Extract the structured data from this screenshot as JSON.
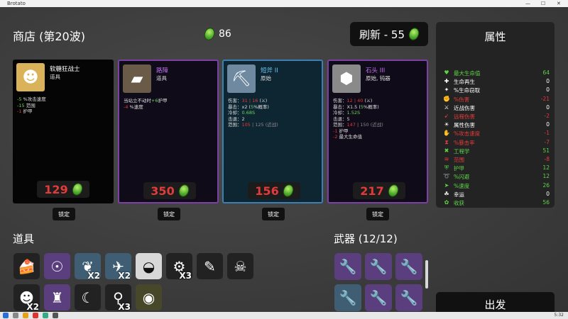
{
  "window": {
    "title": "Brotato"
  },
  "shop": {
    "title": "商店 (第20波)",
    "money": "86",
    "reroll_label": "刷新 - 55"
  },
  "cards": [
    {
      "name": "软糖狂战士",
      "type": "道具",
      "icon": "gummy-berserker-icon",
      "lines": [
        [
          {
            "t": "-5",
            "c": "g"
          },
          {
            "t": " %攻击速度",
            "c": ""
          }
        ],
        [
          {
            "t": "-15",
            "c": "g"
          },
          {
            "t": " 范围",
            "c": ""
          }
        ],
        [
          {
            "t": "-1",
            "c": "r"
          },
          {
            "t": " 护甲",
            "c": ""
          }
        ]
      ],
      "price": "129"
    },
    {
      "name": "路障",
      "type": "道具",
      "icon": "barricade-icon",
      "lines": [
        [
          {
            "t": "当站立不动时",
            "c": ""
          },
          {
            "t": "+6",
            "c": "g"
          },
          {
            "t": "护甲",
            "c": ""
          }
        ],
        [
          {
            "t": "-4",
            "c": "r"
          },
          {
            "t": " %速度",
            "c": ""
          }
        ]
      ],
      "price": "350"
    },
    {
      "name": "短斧 II",
      "type": "原始",
      "icon": "hatchet-icon",
      "lines": [
        [
          {
            "t": "伤害：",
            "c": ""
          },
          {
            "t": "31 | 16",
            "c": "r"
          },
          {
            "t": " (⚔)",
            "c": ""
          }
        ],
        [
          {
            "t": "暴击：x2 (",
            "c": ""
          },
          {
            "t": "5",
            "c": "g"
          },
          {
            "t": "%概率)",
            "c": ""
          }
        ],
        [
          {
            "t": "冷却：",
            "c": ""
          },
          {
            "t": "0.68S",
            "c": "g"
          }
        ],
        [
          {
            "t": "击退：2",
            "c": ""
          }
        ],
        [
          {
            "t": "范围：",
            "c": ""
          },
          {
            "t": "105",
            "c": "r"
          },
          {
            "t": " | 125  (近战)",
            "c": "gr"
          }
        ]
      ],
      "price": "156"
    },
    {
      "name": "石头 III",
      "type": "原始, 钝器",
      "icon": "rock-icon",
      "lines": [
        [
          {
            "t": "伤害：",
            "c": ""
          },
          {
            "t": "12 | 40",
            "c": "r"
          },
          {
            "t": " (⚔)",
            "c": ""
          }
        ],
        [
          {
            "t": "暴击：X1.5 (",
            "c": ""
          },
          {
            "t": "5",
            "c": "g"
          },
          {
            "t": "%概率)",
            "c": ""
          }
        ],
        [
          {
            "t": "冷却：",
            "c": ""
          },
          {
            "t": "1.52S",
            "c": "g"
          }
        ],
        [
          {
            "t": "击退：5",
            "c": ""
          }
        ],
        [
          {
            "t": "范围：",
            "c": ""
          },
          {
            "t": "147",
            "c": "r"
          },
          {
            "t": " | 150  (近战)",
            "c": "gr"
          }
        ],
        [
          {
            "t": "-1",
            "c": "r"
          },
          {
            "t": " 护甲",
            "c": ""
          }
        ],
        [
          {
            "t": "-2",
            "c": "r"
          },
          {
            "t": " 最大生命值",
            "c": ""
          }
        ]
      ],
      "price": "217"
    }
  ],
  "lock_label": "锁定",
  "stats": {
    "title": "属性",
    "rows": [
      {
        "icon": "heart-icon",
        "sym": "♥",
        "label": "最大生命值",
        "value": "64",
        "color": "#5fd447"
      },
      {
        "icon": "regen-icon",
        "sym": "✚",
        "label": "生命再生",
        "value": "0",
        "color": "#ffffff"
      },
      {
        "icon": "lifesteal-icon",
        "sym": "✦",
        "label": "%生命窃取",
        "value": "0",
        "color": "#ffffff"
      },
      {
        "icon": "damage-icon",
        "sym": "✊",
        "label": "%伤害",
        "value": "-21",
        "color": "#e23b3b"
      },
      {
        "icon": "melee-icon",
        "sym": "⚔",
        "label": "近战伤害",
        "value": "0",
        "color": "#ffffff"
      },
      {
        "icon": "ranged-icon",
        "sym": "➹",
        "label": "远程伤害",
        "value": "-2",
        "color": "#e23b3b"
      },
      {
        "icon": "elemental-icon",
        "sym": "☀",
        "label": "属性伤害",
        "value": "0",
        "color": "#ffffff"
      },
      {
        "icon": "attack-speed-icon",
        "sym": "✋",
        "label": "%攻击速度",
        "value": "-1",
        "color": "#e23b3b"
      },
      {
        "icon": "crit-icon",
        "sym": "⧗",
        "label": "%暴击率",
        "value": "-7",
        "color": "#e23b3b"
      },
      {
        "icon": "engineering-icon",
        "sym": "✖",
        "label": "工程学",
        "value": "51",
        "color": "#5fd447"
      },
      {
        "icon": "range-icon",
        "sym": "≋",
        "label": "范围",
        "value": "-8",
        "color": "#e23b3b"
      },
      {
        "icon": "armor-icon",
        "sym": "⛨",
        "label": "护甲",
        "value": "12",
        "color": "#5fd447"
      },
      {
        "icon": "dodge-icon",
        "sym": "➰",
        "label": "%闪避",
        "value": "12",
        "color": "#5fd447"
      },
      {
        "icon": "speed-icon",
        "sym": "➤",
        "label": "%速度",
        "value": "26",
        "color": "#5fd447"
      },
      {
        "icon": "luck-icon",
        "sym": "☘",
        "label": "幸运",
        "value": "0",
        "color": "#ffffff"
      },
      {
        "icon": "harvesting-icon",
        "sym": "✿",
        "label": "收获",
        "value": "56",
        "color": "#5fd447"
      }
    ]
  },
  "inventory": {
    "items_title": "道具",
    "items": [
      {
        "icon": "cake-icon",
        "sym": "🍰",
        "rarity": "",
        "count": ""
      },
      {
        "icon": "amulet-icon",
        "sym": "☉",
        "rarity": "purple",
        "count": ""
      },
      {
        "icon": "feather-icon",
        "sym": "❦",
        "rarity": "blue",
        "count": "X2"
      },
      {
        "icon": "wings-icon",
        "sym": "✈",
        "rarity": "blue",
        "count": "X2"
      },
      {
        "icon": "helmet-icon",
        "sym": "◒",
        "rarity": "white",
        "count": ""
      },
      {
        "icon": "saw-icon",
        "sym": "⚙",
        "rarity": "",
        "count": "X3"
      },
      {
        "icon": "pencil-icon",
        "sym": "✎",
        "rarity": "",
        "count": ""
      },
      {
        "icon": "skull-icon",
        "sym": "☠",
        "rarity": "",
        "count": ""
      },
      {
        "icon": "gummy-icon",
        "sym": "☻",
        "rarity": "",
        "count": "X2"
      },
      {
        "icon": "jacket-icon",
        "sym": "♜",
        "rarity": "purple",
        "count": ""
      },
      {
        "icon": "crescent-icon",
        "sym": "☾",
        "rarity": "",
        "count": ""
      },
      {
        "icon": "lamp-icon",
        "sym": "⚲",
        "rarity": "",
        "count": "X3"
      },
      {
        "icon": "egg-icon",
        "sym": "◉",
        "rarity": "yellow",
        "count": ""
      }
    ],
    "weapons_title": "武器 (12/12)",
    "weapons": [
      {
        "icon": "wrench-icon",
        "rarity": "purple"
      },
      {
        "icon": "wrench-icon",
        "rarity": "purple"
      },
      {
        "icon": "wrench-icon",
        "rarity": "purple"
      },
      {
        "icon": "wrench-icon",
        "rarity": "blue"
      },
      {
        "icon": "wrench-icon",
        "rarity": "purple"
      },
      {
        "icon": "wrench-icon",
        "rarity": "purple"
      }
    ]
  },
  "go_label": "出发",
  "clock": "5:32"
}
